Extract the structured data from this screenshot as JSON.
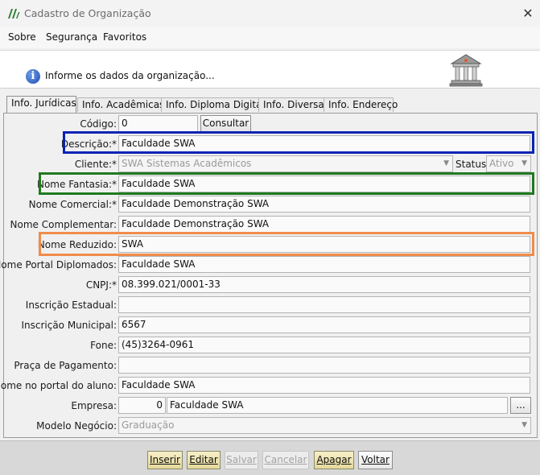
{
  "window": {
    "title": "Cadastro de Organização"
  },
  "menu": {
    "items": [
      "Sobre",
      "Segurança",
      "Favoritos"
    ]
  },
  "banner": {
    "text": "Informe os dados da organização..."
  },
  "tabs": [
    "Info. Jurídicas",
    "Info. Acadêmicas",
    "Info. Diploma Digital",
    "Info. Diversas",
    "Info. Endereço"
  ],
  "form": {
    "codigo": {
      "label": "Código:",
      "value": "0",
      "button": "Consultar"
    },
    "descricao": {
      "label": "Descrição:*",
      "value": "Faculdade SWA"
    },
    "cliente": {
      "label": "Cliente:*",
      "value": "SWA Sistemas Acadêmicos",
      "status_label": "Status:",
      "status_value": "Ativo"
    },
    "nome_fantasia": {
      "label": "Nome Fantasia:*",
      "value": "Faculdade SWA"
    },
    "nome_comercial": {
      "label": "Nome Comercial:*",
      "value": "Faculdade Demonstração SWA"
    },
    "nome_complementar": {
      "label": "Nome Complementar:",
      "value": "Faculdade Demonstração SWA"
    },
    "nome_reduzido": {
      "label": "Nome Reduzido:",
      "value": "SWA"
    },
    "nome_portal_diplomados": {
      "label": "Nome Portal Diplomados:",
      "value": "Faculdade SWA"
    },
    "cnpj": {
      "label": "CNPJ:*",
      "value": "08.399.021/0001-33"
    },
    "inscricao_estadual": {
      "label": "Inscrição Estadual:",
      "value": ""
    },
    "inscricao_municipal": {
      "label": "Inscrição Municipal:",
      "value": "6567"
    },
    "fone": {
      "label": "Fone:",
      "value": "(45)3264-0961"
    },
    "praca_pagamento": {
      "label": "Praça de Pagamento:",
      "value": ""
    },
    "nome_portal_aluno": {
      "label": "Nome no portal do aluno:",
      "value": "Faculdade SWA"
    },
    "empresa": {
      "label": "Empresa:",
      "code": "0",
      "value": "Faculdade SWA",
      "button": "..."
    },
    "modelo_negocio": {
      "label": "Modelo Negócio:",
      "value": "Graduação"
    }
  },
  "footer": {
    "buttons": [
      "Inserir",
      "Editar",
      "Salvar",
      "Cancelar",
      "Apagar",
      "Voltar"
    ]
  },
  "colors": {
    "highlight_blue": "#0a23b4",
    "highlight_green": "#1f7a1f",
    "highlight_orange": "#f08c4a"
  }
}
